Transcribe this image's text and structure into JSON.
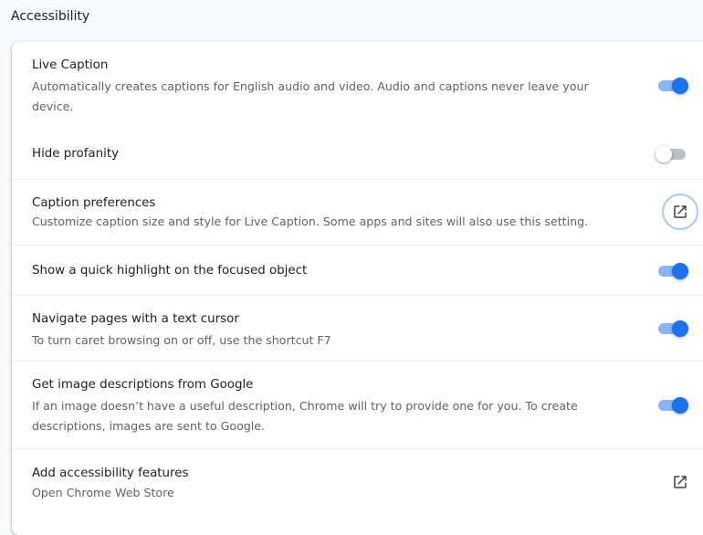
{
  "section": {
    "title": "Accessibility"
  },
  "settings": {
    "live_caption": {
      "label": "Live Caption",
      "description": "Automatically creates captions for English audio and video. Audio and captions never leave your device.",
      "enabled": true
    },
    "hide_profanity": {
      "label": "Hide profanity",
      "enabled": false
    },
    "caption_preferences": {
      "label": "Caption preferences",
      "description": "Customize caption size and style for Live Caption. Some apps and sites will also use this setting.",
      "icon": "open-in-new-icon"
    },
    "focus_highlight": {
      "label": "Show a quick highlight on the focused object",
      "enabled": true
    },
    "caret_browsing": {
      "label": "Navigate pages with a text cursor",
      "description": "To turn caret browsing on or off, use the shortcut F7",
      "enabled": true
    },
    "image_descriptions": {
      "label": "Get image descriptions from Google",
      "description": "If an image doesn’t have a useful description, Chrome will try to provide one for you. To create descriptions, images are sent to Google.",
      "enabled": true
    },
    "add_accessibility_features": {
      "label": "Add accessibility features",
      "description": "Open Chrome Web Store",
      "icon": "open-in-new-icon"
    }
  },
  "colors": {
    "accent": "#1a73e8",
    "accent_track": "#8ab4f8",
    "off_track": "#bdc1c6",
    "secondary_text": "#5f6368",
    "divider": "#e8eaed"
  }
}
